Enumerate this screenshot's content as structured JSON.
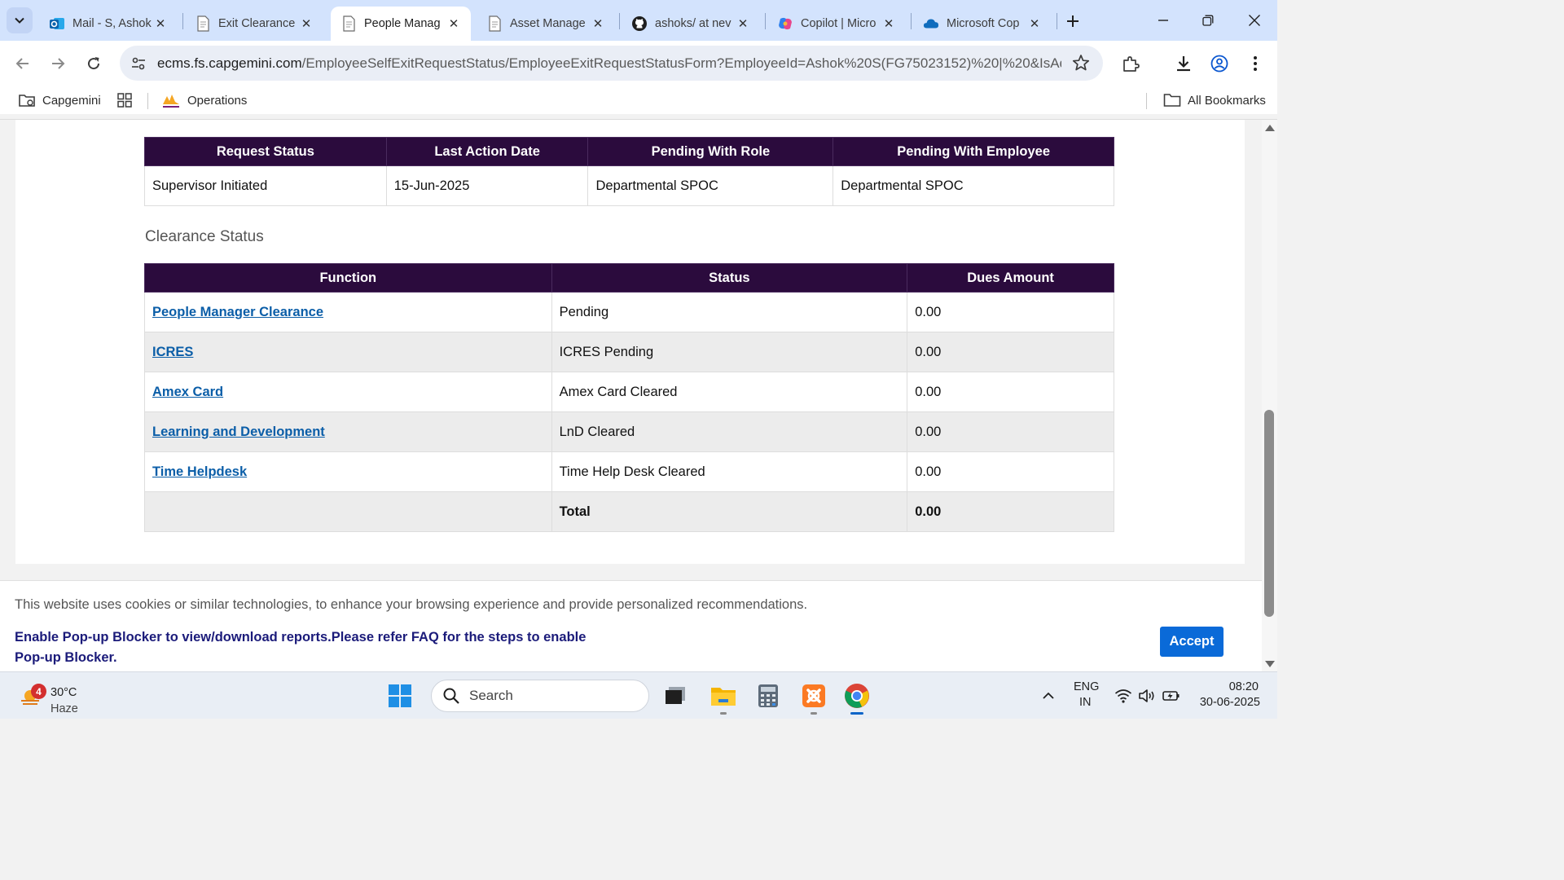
{
  "browser": {
    "tabs": [
      {
        "title": "Mail - S, Ashok",
        "icon": "outlook-icon",
        "active": false
      },
      {
        "title": "Exit Clearance",
        "icon": "document-icon",
        "active": false
      },
      {
        "title": "People Manag",
        "icon": "document-icon",
        "active": true
      },
      {
        "title": "Asset Manage",
        "icon": "document-icon",
        "active": false
      },
      {
        "title": "ashoks/ at nev",
        "icon": "github-icon",
        "active": false
      },
      {
        "title": "Copilot | Micro",
        "icon": "copilot-icon",
        "active": false
      },
      {
        "title": "Microsoft Cop",
        "icon": "onedrive-icon",
        "active": false
      }
    ],
    "url_host": "ecms.fs.capgemini.com",
    "url_path": "/EmployeeSelfExitRequestStatus/EmployeeExitRequestStatusForm?EmployeeId=Ashok%20S(FG75023152)%20|%20&IsAd...",
    "bookmarks": {
      "capgemini": "Capgemini",
      "operations": "Operations",
      "all_bookmarks": "All Bookmarks"
    }
  },
  "request_table": {
    "headers": [
      "Request Status",
      "Last Action Date",
      "Pending With Role",
      "Pending With Employee"
    ],
    "row": [
      "Supervisor Initiated",
      "15-Jun-2025",
      "Departmental SPOC",
      "Departmental SPOC"
    ]
  },
  "clearance": {
    "title": "Clearance Status",
    "headers": [
      "Function",
      "Status",
      "Dues Amount"
    ],
    "rows": [
      {
        "function": "People Manager Clearance",
        "status": "Pending",
        "dues": "0.00"
      },
      {
        "function": "ICRES",
        "status": "ICRES Pending",
        "dues": "0.00"
      },
      {
        "function": "Amex Card",
        "status": "Amex Card Cleared",
        "dues": "0.00"
      },
      {
        "function": "Learning and Development",
        "status": "LnD Cleared",
        "dues": "0.00"
      },
      {
        "function": "Time Helpdesk",
        "status": "Time Help Desk Cleared",
        "dues": "0.00"
      }
    ],
    "total_label": "Total",
    "total_value": "0.00"
  },
  "cookie_banner": {
    "message": "This website uses cookies or similar technologies, to enhance your browsing experience and provide personalized recommendations.",
    "popup_notice": "Enable Pop-up Blocker to view/download reports.Please refer FAQ for the steps to enable Pop-up Blocker.",
    "accept_label": "Accept"
  },
  "taskbar": {
    "weather_badge": "4",
    "temperature": "30°C",
    "condition": "Haze",
    "search_placeholder": "Search",
    "language": "ENG",
    "region": "IN",
    "time": "08:20",
    "date": "30-06-2025"
  },
  "colors": {
    "table_header": "#2b0b3d",
    "link": "#0b5ea8",
    "accept_button": "#0a6ad8",
    "tabstrip": "#d3e3fd"
  }
}
